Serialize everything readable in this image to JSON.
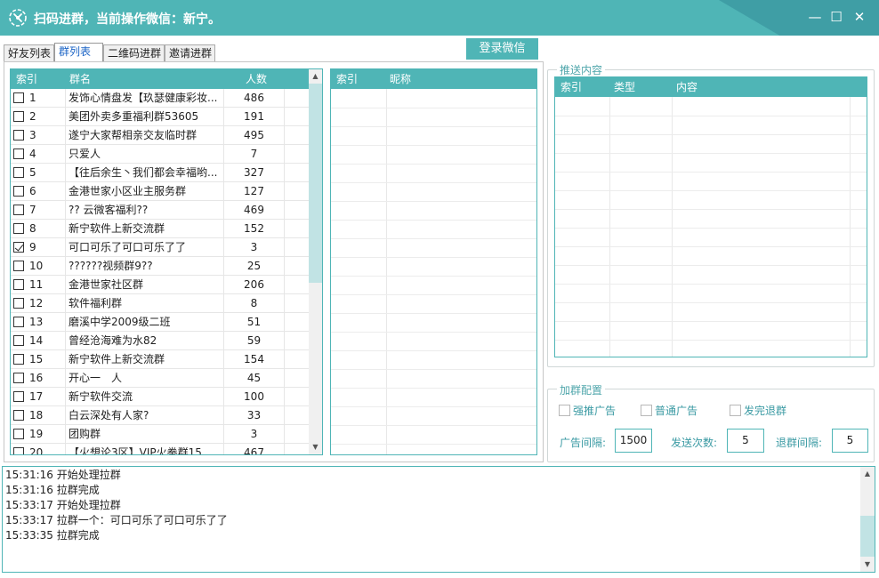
{
  "window": {
    "title": "扫码进群，当前操作微信：新宁。",
    "controls": {
      "minimize": "—",
      "maximize": "☐",
      "close": "✕"
    }
  },
  "tabs": [
    {
      "label": "好友列表",
      "active": false
    },
    {
      "label": "群列表",
      "active": true
    },
    {
      "label": "二维码进群",
      "active": false
    },
    {
      "label": "邀请进群",
      "active": false
    }
  ],
  "login_button": "登录微信",
  "group_table": {
    "headers": [
      "索引",
      "群名",
      "人数"
    ],
    "rows": [
      {
        "checked": false,
        "index": "1",
        "name": "发饰心情盘发【玖瑟健康彩妆...",
        "count": "486"
      },
      {
        "checked": false,
        "index": "2",
        "name": "美团外卖多重福利群53605",
        "count": "191"
      },
      {
        "checked": false,
        "index": "3",
        "name": "遂宁大家帮相亲交友临时群",
        "count": "495"
      },
      {
        "checked": false,
        "index": "4",
        "name": "只爱人",
        "count": "7"
      },
      {
        "checked": false,
        "index": "5",
        "name": "【往后余生丶我们都会幸福哟...",
        "count": "327"
      },
      {
        "checked": false,
        "index": "6",
        "name": "金港世家小区业主服务群",
        "count": "127"
      },
      {
        "checked": false,
        "index": "7",
        "name": "?? 云微客福利??",
        "count": "469"
      },
      {
        "checked": false,
        "index": "8",
        "name": "新宁软件上新交流群",
        "count": "152"
      },
      {
        "checked": true,
        "index": "9",
        "name": "可口可乐了可口可乐了了",
        "count": "3"
      },
      {
        "checked": false,
        "index": "10",
        "name": "??????视频群9??",
        "count": "25"
      },
      {
        "checked": false,
        "index": "11",
        "name": "金港世家社区群",
        "count": "206"
      },
      {
        "checked": false,
        "index": "12",
        "name": "软件福利群",
        "count": "8"
      },
      {
        "checked": false,
        "index": "13",
        "name": "磨溪中学2009级二班",
        "count": "51"
      },
      {
        "checked": false,
        "index": "14",
        "name": "曾经沧海难为水82",
        "count": "59"
      },
      {
        "checked": false,
        "index": "15",
        "name": "新宁软件上新交流群",
        "count": "154"
      },
      {
        "checked": false,
        "index": "16",
        "name": "开心一　人",
        "count": "45"
      },
      {
        "checked": false,
        "index": "17",
        "name": "新宁软件交流",
        "count": "100"
      },
      {
        "checked": false,
        "index": "18",
        "name": "白云深处有人家?",
        "count": "33"
      },
      {
        "checked": false,
        "index": "19",
        "name": "团购群",
        "count": "3"
      },
      {
        "checked": false,
        "index": "20",
        "name": "【火想论3区】VIP火拳群15",
        "count": "467"
      }
    ],
    "scroll": {
      "up": "▲",
      "down": "▼"
    }
  },
  "member_table": {
    "headers": [
      "索引",
      "昵称"
    ]
  },
  "push_content": {
    "title": "推送内容",
    "headers": [
      "索引",
      "类型",
      "内容"
    ]
  },
  "join_config": {
    "title": "加群配置",
    "options": [
      {
        "label": "强推广告",
        "checked": false
      },
      {
        "label": "普通广告",
        "checked": false
      },
      {
        "label": "发完退群",
        "checked": false
      }
    ],
    "ad_interval_label": "广告间隔:",
    "ad_interval_value": "1500",
    "send_count_label": "发送次数:",
    "send_count_value": "5",
    "quit_interval_label": "退群间隔:",
    "quit_interval_value": "5"
  },
  "log": {
    "lines": [
      "15:31:16 开始处理拉群",
      "15:31:16 拉群完成",
      "15:33:17 开始处理拉群",
      "15:33:17 拉群一个：可口可乐了可口可乐了了",
      "15:33:35 拉群完成"
    ],
    "scroll": {
      "up": "▲",
      "down": "▼"
    }
  }
}
